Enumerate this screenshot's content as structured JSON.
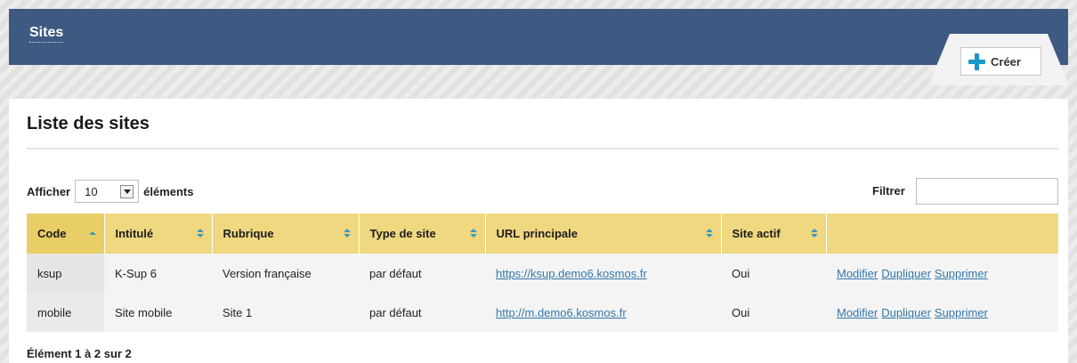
{
  "header": {
    "title": "Sites",
    "create_label": "Créer"
  },
  "panel": {
    "title": "Liste des sites"
  },
  "length_control": {
    "prefix": "Afficher",
    "value": "10",
    "suffix": "éléments"
  },
  "filter": {
    "label": "Filtrer",
    "value": ""
  },
  "table": {
    "columns": [
      "Code",
      "Intitulé",
      "Rubrique",
      "Type de site",
      "URL principale",
      "Site actif",
      ""
    ],
    "rows": [
      {
        "code": "ksup",
        "label": "K-Sup 6",
        "section": "Version française",
        "type": "par défaut",
        "url": "https://ksup.demo6.kosmos.fr",
        "active": "Oui",
        "actions": [
          "Modifier",
          "Dupliquer",
          "Supprimer"
        ]
      },
      {
        "code": "mobile",
        "label": "Site mobile",
        "section": "Site 1",
        "type": "par défaut",
        "url": "http://m.demo6.kosmos.fr",
        "active": "Oui",
        "actions": [
          "Modifier",
          "Dupliquer",
          "Supprimer"
        ]
      }
    ]
  },
  "info": "Élément 1 à 2 sur 2",
  "colors": {
    "header_bg": "#3e5a83",
    "table_header_bg": "#f0d880",
    "link": "#3377aa",
    "accent": "#1a97c7"
  },
  "icons": {
    "create": "plus-icon",
    "sort": "sort-icon",
    "dropdown": "chevron-down-icon"
  }
}
